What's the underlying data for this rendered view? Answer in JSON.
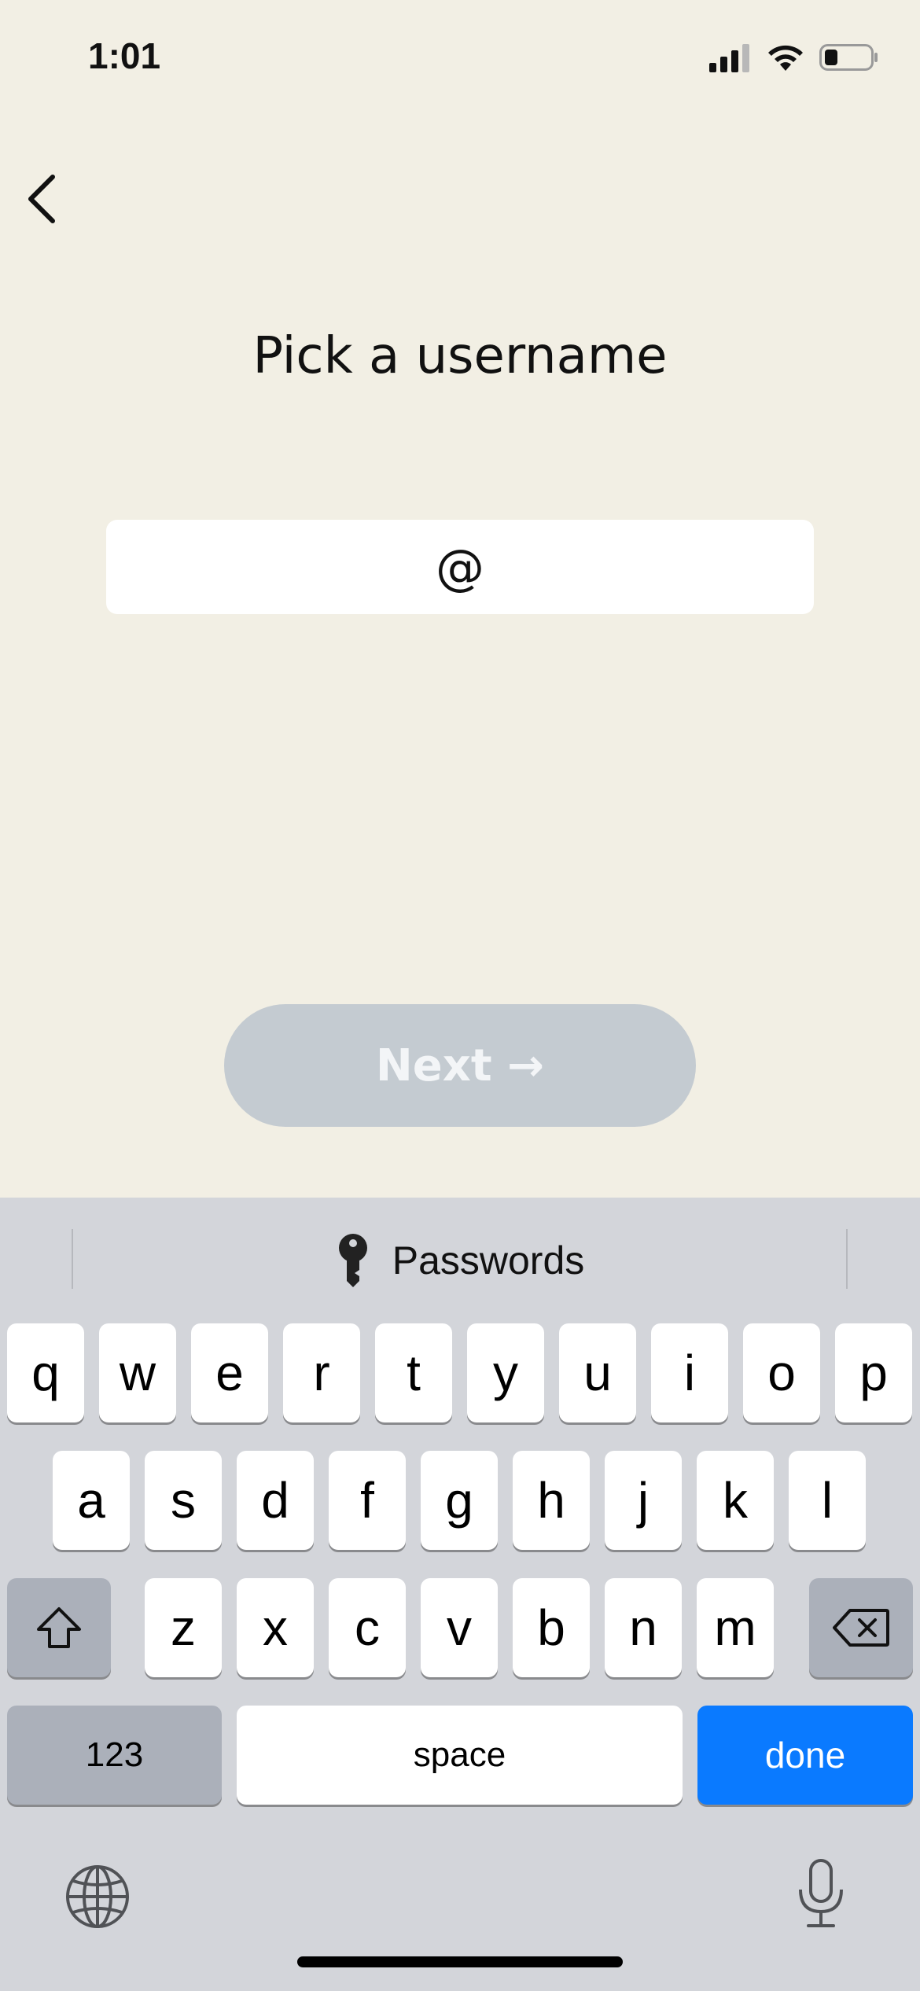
{
  "status_bar": {
    "time": "1:01",
    "battery_level": 0.25
  },
  "title": "Pick a username",
  "username_field": {
    "prefix": "@",
    "value": ""
  },
  "next_button": {
    "label": "Next →"
  },
  "keyboard": {
    "suggestion": "Passwords",
    "row1": [
      "q",
      "w",
      "e",
      "r",
      "t",
      "y",
      "u",
      "i",
      "o",
      "p"
    ],
    "row2": [
      "a",
      "s",
      "d",
      "f",
      "g",
      "h",
      "j",
      "k",
      "l"
    ],
    "row3": [
      "z",
      "x",
      "c",
      "v",
      "b",
      "n",
      "m"
    ],
    "numbers_label": "123",
    "space_label": "space",
    "done_label": "done"
  },
  "colors": {
    "background": "#f2efe4",
    "keyboard_bg": "#d3d5da",
    "done_blue": "#0a7aff",
    "next_disabled": "#c4cbd1"
  }
}
